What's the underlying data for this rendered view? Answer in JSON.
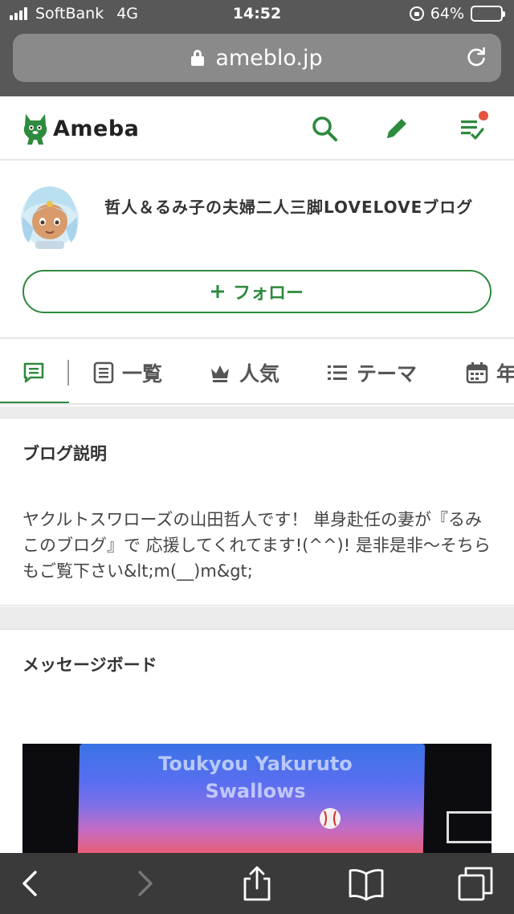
{
  "status_bar": {
    "carrier": "SoftBank",
    "network": "4G",
    "time": "14:52",
    "battery": "64%",
    "battery_level": 0.64
  },
  "browser": {
    "url": "ameblo.jp"
  },
  "header": {
    "logo_text": "Ameba",
    "icons": [
      "search-icon",
      "pencil-icon",
      "reading-list-icon"
    ],
    "accent_color": "#2d8a3e",
    "notification_color": "#e5533f"
  },
  "profile": {
    "blog_title": "哲人＆るみ子の夫婦二人三脚LOVELOVEブログ",
    "follow_label": "フォロー"
  },
  "tabs": [
    {
      "icon": "chat-icon",
      "label": ""
    },
    {
      "icon": "list-icon",
      "label": "一覧"
    },
    {
      "icon": "crown-icon",
      "label": "人気"
    },
    {
      "icon": "bullets-icon",
      "label": "テーマ"
    },
    {
      "icon": "calendar-icon",
      "label": "年"
    }
  ],
  "blog_description": {
    "title": "ブログ説明",
    "text": "ヤクルトスワローズの山田哲人です！ 単身赴任の妻が『るみこのブログ』で 応援してくれてます!(^^)! 是非是非〜そちらもご覧下さい&lt;m(__)m&gt;"
  },
  "message_board": {
    "title": "メッセージボード",
    "image_text": "Toukyou Yakuruto Swallows"
  },
  "toolbar": {
    "icons": [
      "back-icon",
      "forward-icon",
      "share-icon",
      "bookmarks-icon",
      "tabs-icon"
    ]
  }
}
